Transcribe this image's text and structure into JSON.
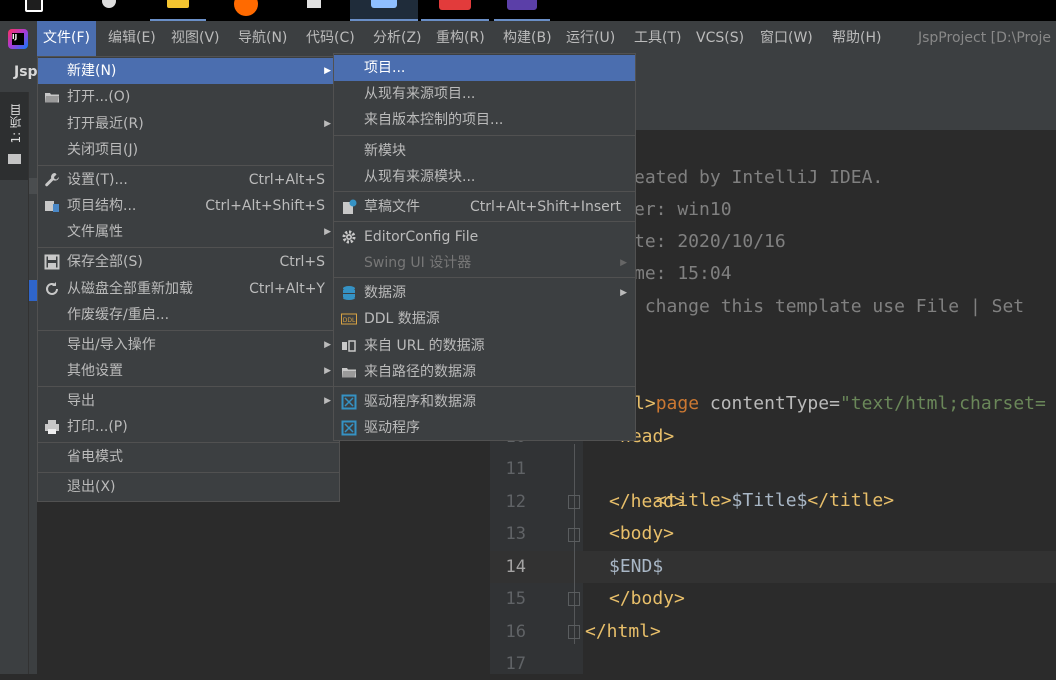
{
  "menubar": {
    "items": [
      "文件(F)",
      "编辑(E)",
      "视图(V)",
      "导航(N)",
      "代码(C)",
      "分析(Z)",
      "重构(R)",
      "构建(B)",
      "运行(U)",
      "工具(T)",
      "VCS(S)",
      "窗口(W)",
      "帮助(H)"
    ],
    "window_title": "JspProject [D:\\Proje"
  },
  "tabrow": {
    "tab_fragment": "Jsp"
  },
  "toolwindow": {
    "project_tab": "1: 项目"
  },
  "file_menu": {
    "items": [
      {
        "label": "新建(N)",
        "shortcut": "",
        "submenu": true,
        "icon": ""
      },
      {
        "label": "打开...(O)",
        "shortcut": "",
        "submenu": false,
        "icon": "folder-icon"
      },
      {
        "label": "打开最近(R)",
        "shortcut": "",
        "submenu": true,
        "icon": ""
      },
      {
        "label": "关闭项目(J)",
        "shortcut": "",
        "submenu": false,
        "icon": ""
      },
      {
        "label": "设置(T)...",
        "shortcut": "Ctrl+Alt+S",
        "submenu": false,
        "icon": "wrench-icon"
      },
      {
        "label": "项目结构...",
        "shortcut": "Ctrl+Alt+Shift+S",
        "submenu": false,
        "icon": "project-structure-icon"
      },
      {
        "label": "文件属性",
        "shortcut": "",
        "submenu": true,
        "icon": ""
      },
      {
        "label": "保存全部(S)",
        "shortcut": "Ctrl+S",
        "submenu": false,
        "icon": "save-icon"
      },
      {
        "label": "从磁盘全部重新加载",
        "shortcut": "Ctrl+Alt+Y",
        "submenu": false,
        "icon": "reload-icon"
      },
      {
        "label": "作废缓存/重启...",
        "shortcut": "",
        "submenu": false,
        "icon": ""
      },
      {
        "label": "导出/导入操作",
        "shortcut": "",
        "submenu": true,
        "icon": ""
      },
      {
        "label": "其他设置",
        "shortcut": "",
        "submenu": true,
        "icon": ""
      },
      {
        "label": "导出",
        "shortcut": "",
        "submenu": true,
        "icon": ""
      },
      {
        "label": "打印...(P)",
        "shortcut": "",
        "submenu": false,
        "icon": "printer-icon"
      },
      {
        "label": "省电模式",
        "shortcut": "",
        "submenu": false,
        "icon": ""
      },
      {
        "label": "退出(X)",
        "shortcut": "",
        "submenu": false,
        "icon": ""
      }
    ]
  },
  "new_submenu": {
    "items": [
      {
        "label": "项目...",
        "shortcut": "",
        "submenu": false,
        "icon": ""
      },
      {
        "label": "从现有来源项目...",
        "shortcut": "",
        "submenu": false,
        "icon": ""
      },
      {
        "label": "来自版本控制的项目...",
        "shortcut": "",
        "submenu": false,
        "icon": ""
      },
      {
        "label": "新模块",
        "shortcut": "",
        "submenu": false,
        "icon": ""
      },
      {
        "label": "从现有来源模块...",
        "shortcut": "",
        "submenu": false,
        "icon": ""
      },
      {
        "label": "草稿文件",
        "shortcut": "Ctrl+Alt+Shift+Insert",
        "submenu": false,
        "icon": "scratch-file-icon"
      },
      {
        "label": "EditorConfig File",
        "shortcut": "",
        "submenu": false,
        "icon": "gear-icon"
      },
      {
        "label": "Swing UI 设计器",
        "shortcut": "",
        "submenu": true,
        "icon": ""
      },
      {
        "label": "数据源",
        "shortcut": "",
        "submenu": true,
        "icon": "database-icon"
      },
      {
        "label": "DDL 数据源",
        "shortcut": "",
        "submenu": false,
        "icon": "ddl-icon"
      },
      {
        "label": "来自 URL 的数据源",
        "shortcut": "",
        "submenu": false,
        "icon": "url-datasource-icon"
      },
      {
        "label": "来自路径的数据源",
        "shortcut": "",
        "submenu": false,
        "icon": "folder-datasource-icon"
      },
      {
        "label": "驱动程序和数据源",
        "shortcut": "",
        "submenu": false,
        "icon": "driver-datasource-icon"
      },
      {
        "label": "驱动程序",
        "shortcut": "",
        "submenu": false,
        "icon": "driver-icon"
      }
    ]
  },
  "editor": {
    "comment_lines": [
      "eated by IntelliJ IDEA.",
      "er: win10",
      "te: 2020/10/16",
      "me: 15:04",
      " change this template use File | Set"
    ],
    "page_directive": {
      "kw": "page",
      "attr": " contentType=",
      "value": "\"text/html;charset="
    },
    "code_lines": [
      {
        "num": "",
        "html": "l>"
      },
      {
        "num": "10",
        "html": "head>"
      },
      {
        "num": "11",
        "html": "<title>$Title$</title>"
      },
      {
        "num": "12",
        "html": "</head>"
      },
      {
        "num": "13",
        "html": "<body>"
      },
      {
        "num": "14",
        "html": "$END$"
      },
      {
        "num": "15",
        "html": "</body>"
      },
      {
        "num": "16",
        "html": "</html>"
      },
      {
        "num": "17",
        "html": ""
      }
    ]
  },
  "colors": {
    "accent": "#4b6eaf",
    "menu_bg": "#3c3f41",
    "editor_bg": "#2b2b2b",
    "tag": "#e8bf6a",
    "string": "#6a8759",
    "comment": "#808080"
  }
}
